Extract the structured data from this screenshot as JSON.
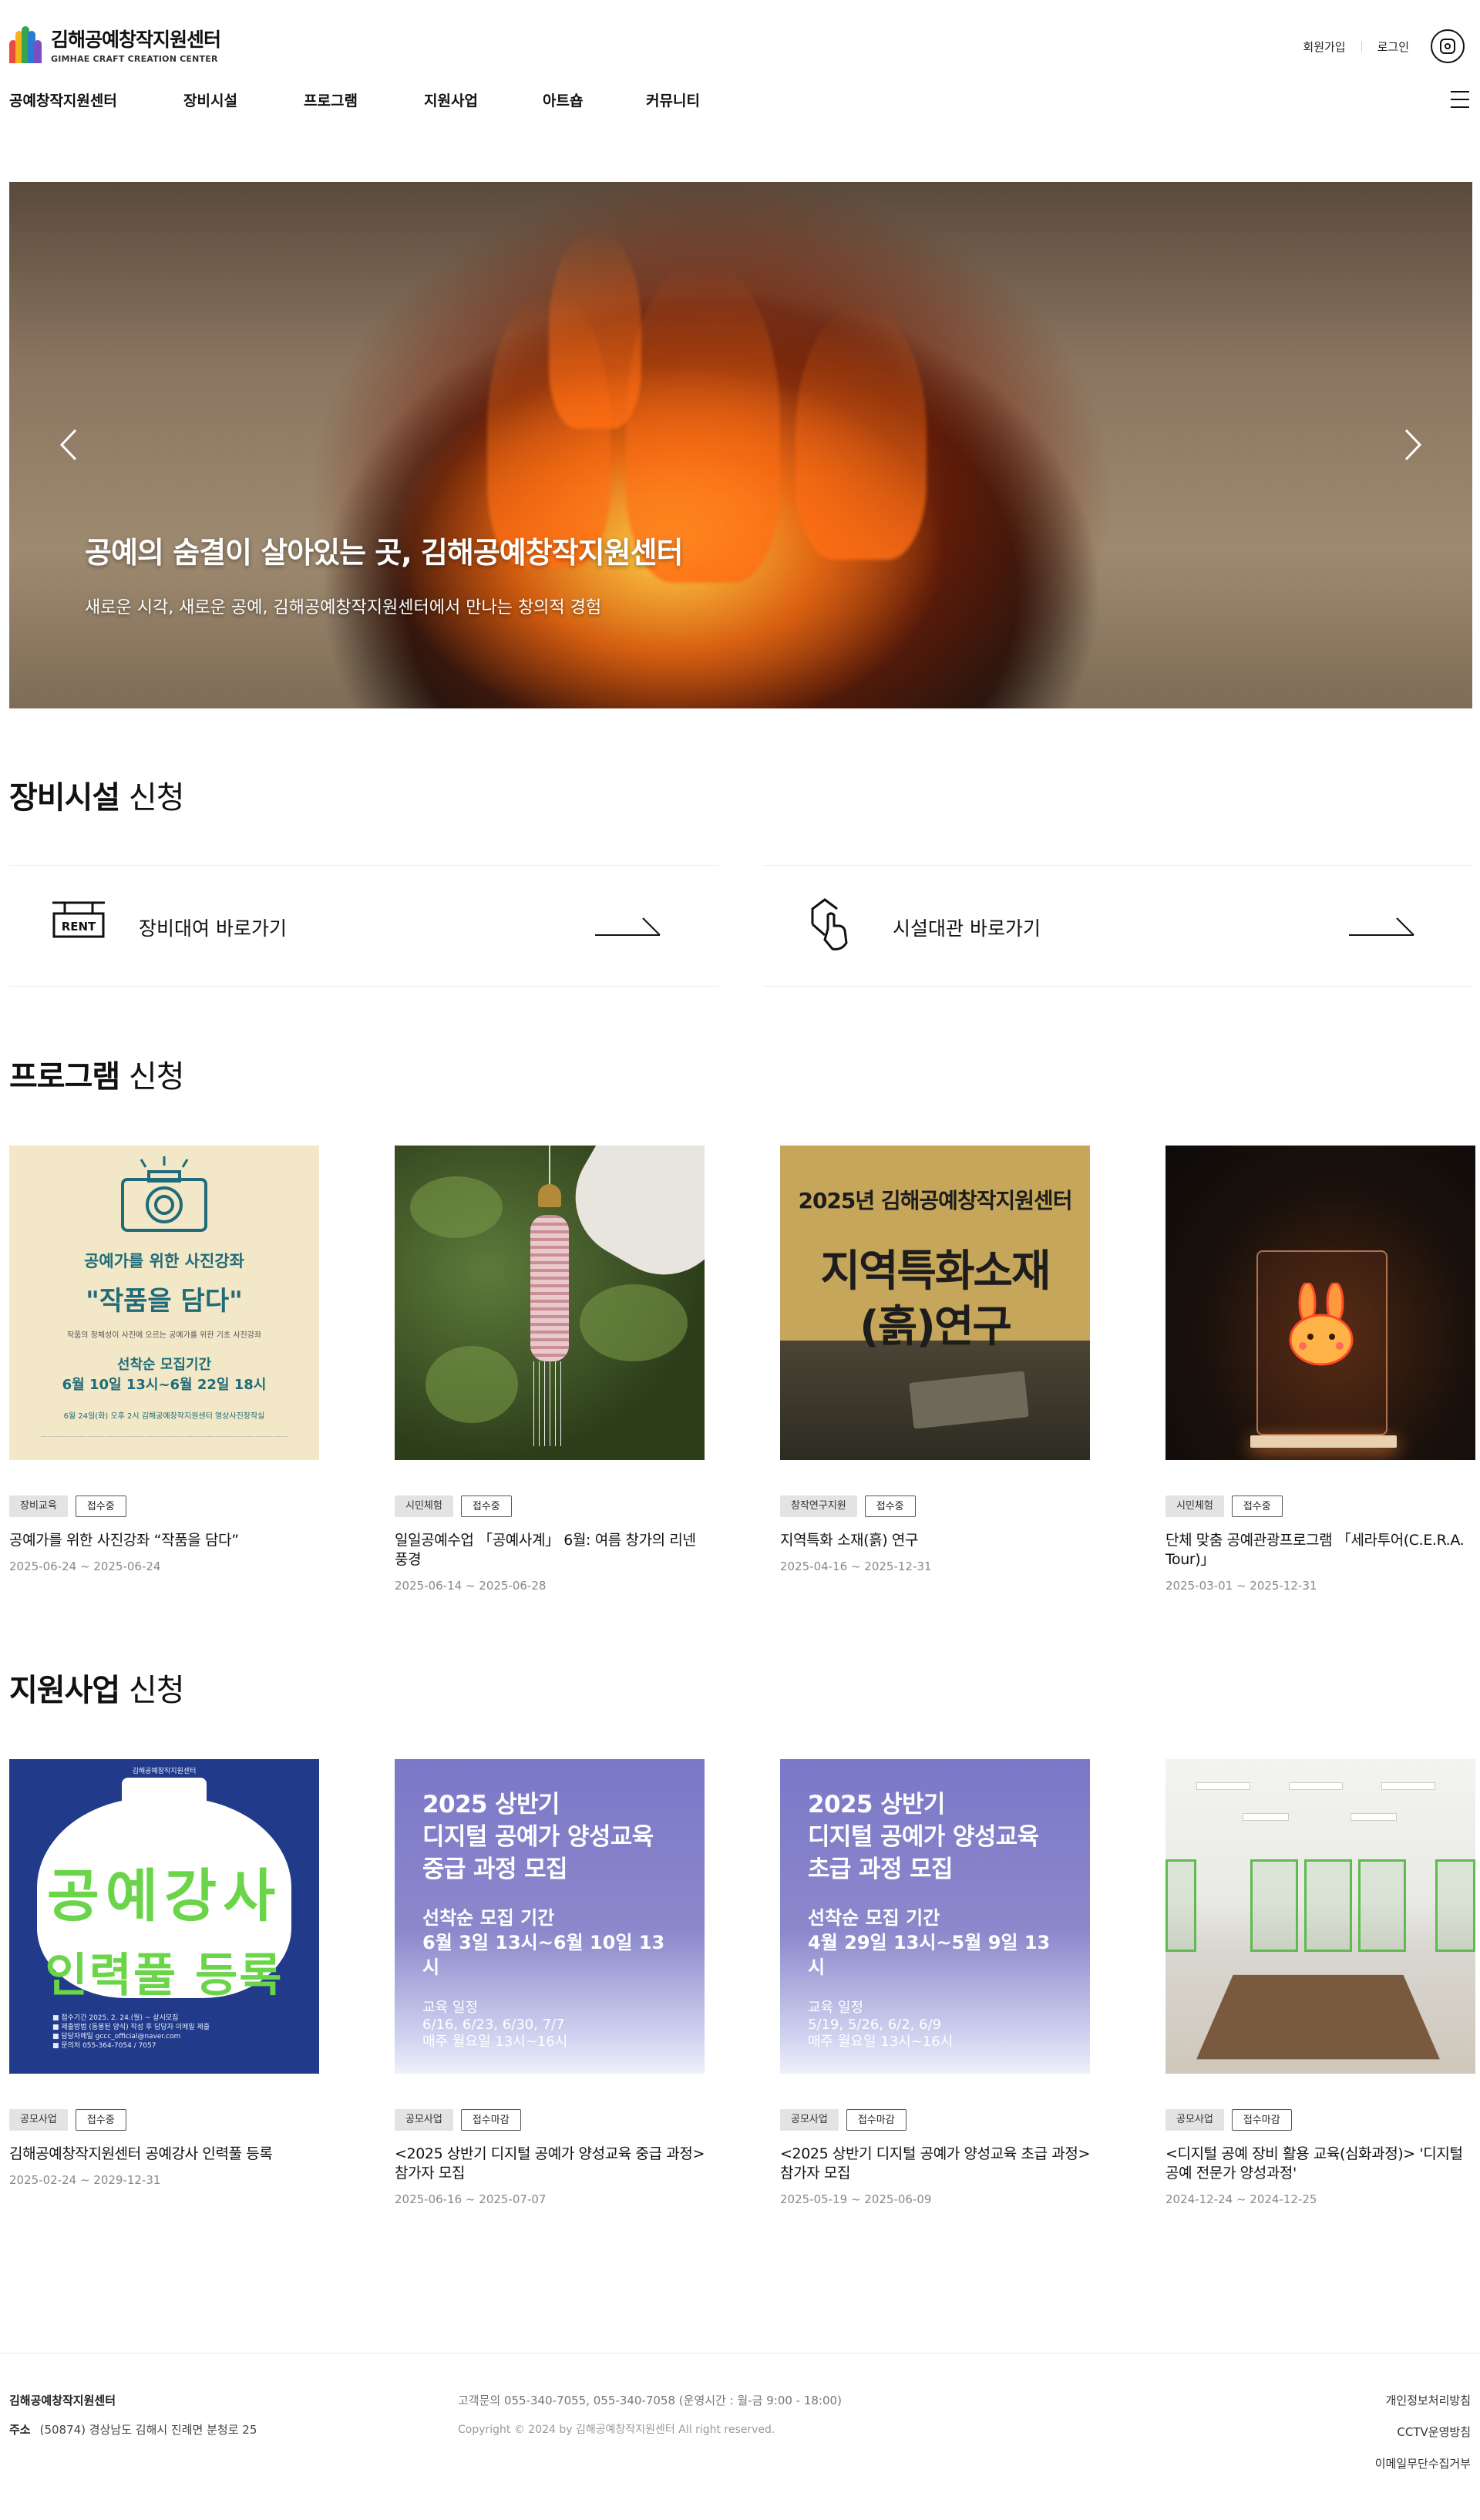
{
  "header": {
    "logo_kor": "김해공예창작지원센터",
    "logo_eng": "GIMHAE CRAFT CREATION CENTER",
    "util": {
      "signup": "회원가입",
      "login": "로그인"
    },
    "gnb": [
      "공예창작지원센터",
      "장비시설",
      "프로그램",
      "지원사업",
      "아트숍",
      "커뮤니티"
    ]
  },
  "hero": {
    "title": "공예의 숨결이 살아있는 곳, 김해공예창작지원센터",
    "subtitle": "새로운 시각, 새로운 공예, 김해공예창작지원센터에서 만나는 창의적 경험"
  },
  "facility": {
    "title_bold": "장비시설",
    "title_light": " 신청",
    "links": [
      {
        "label": "장비대여 바로가기",
        "icon": "rent-sign-icon",
        "icon_text": "RENT"
      },
      {
        "label": "시설대관 바로가기",
        "icon": "building-hand-icon"
      }
    ]
  },
  "program": {
    "title_bold": "프로그램",
    "title_light": " 신청",
    "cards": [
      {
        "category": "장비교육",
        "status": "접수중",
        "title": "공예가를 위한 사진강좌 “작품을 담다”",
        "date": "2025-06-24 ~ 2025-06-24",
        "thumb": {
          "t1": "공예가를 위한 사진강좌",
          "t2": "\"작품을 담다\"",
          "t3": "작품의 정체성이 사진에 오르는 공예가를 위한 기초 사진강좌",
          "t4a": "선착순 모집기간",
          "t4b": "6월 10일 13시~6월 22일 18시",
          "t5": "6월 24일(화) 오후 2시  김해공예창작지원센터 영상사진창작실"
        }
      },
      {
        "category": "시민체험",
        "status": "접수중",
        "title": "일일공예수업 「공예사계」 6월: 여름 창가의 리넨 풍경",
        "date": "2025-06-14 ~ 2025-06-28"
      },
      {
        "category": "창작연구지원",
        "status": "접수중",
        "title": "지역특화 소재(흙) 연구",
        "date": "2025-04-16 ~ 2025-12-31",
        "thumb": {
          "l1": "2025년 김해공예창작지원센터",
          "l2": "지역특화소재",
          "l3": "(흙)연구"
        }
      },
      {
        "category": "시민체험",
        "status": "접수중",
        "title": "단체 맞춤 공예관광프로그램 「세라투어(C.E.R.A. Tour)」",
        "date": "2025-03-01 ~ 2025-12-31"
      }
    ]
  },
  "support": {
    "title_bold": "지원사업",
    "title_light": " 신청",
    "cards": [
      {
        "category": "공모사업",
        "status": "접수중",
        "title": "김해공예창작지원센터 공예강사 인력풀 등록",
        "date": "2025-02-24 ~ 2029-12-31",
        "thumb": {
          "head": "김해공예창작지원센터",
          "big": "공예강사",
          "big2": "인력풀 등록",
          "lines": [
            "■ 접수기간   2025. 2. 24.(월) ~ 상시모집",
            "■ 제출방법   (동봉된 양식) 작성 후 담당자 이메일 제출",
            "■ 담당자메일  gccc_official@naver.com",
            "■ 문의처     055-364-7054 / 7057"
          ]
        }
      },
      {
        "category": "공모사업",
        "status": "접수마감",
        "title": "<2025 상반기 디지털 공예가 양성교육 중급 과정> 참가자 모집",
        "date": "2025-06-16 ~ 2025-07-07",
        "thumb": {
          "p1": "2025 상반기\n디지털 공예가 양성교육\n중급 과정 모집",
          "p2": "선착순 모집 기간\n6월 3일 13시~6월 10일 13시",
          "p3": "교육 일정\n6/16, 6/23, 6/30, 7/7\n매주 월요일 13시~16시"
        }
      },
      {
        "category": "공모사업",
        "status": "접수마감",
        "title": "<2025 상반기 디지털 공예가 양성교육 초급 과정> 참가자 모집",
        "date": "2025-05-19 ~ 2025-06-09",
        "thumb": {
          "p1": "2025 상반기\n디지털 공예가 양성교육\n초급 과정 모집",
          "p2": "선착순 모집 기간\n4월 29일 13시~5월 9일 13시",
          "p3": "교육 일정\n5/19, 5/26, 6/2, 6/9\n매주 월요일 13시~16시"
        }
      },
      {
        "category": "공모사업",
        "status": "접수마감",
        "title": "<디지털 공예 장비 활용 교육(심화과정)> '디지털 공예 전문가 양성과정'",
        "date": "2024-12-24 ~ 2024-12-25"
      }
    ]
  },
  "footer": {
    "name": "김해공예창작지원센터",
    "addr_label": "주소",
    "addr": "(50874) 경상남도 김해시 진례면 분청로 25",
    "contact": "고객문의  055-340-7055, 055-340-7058 (운영시간 : 월-금 9:00 - 18:00)",
    "copy": "Copyright © 2024 by 김해공예창작지원센터 All right reserved.",
    "links": [
      "개인정보처리방침",
      "CCTV운영방침",
      "이메일무단수집거부"
    ]
  },
  "colors": {
    "accent_green": "#6bd54a",
    "clay_blue": "#213a8a",
    "purple": "#7a78c8"
  }
}
